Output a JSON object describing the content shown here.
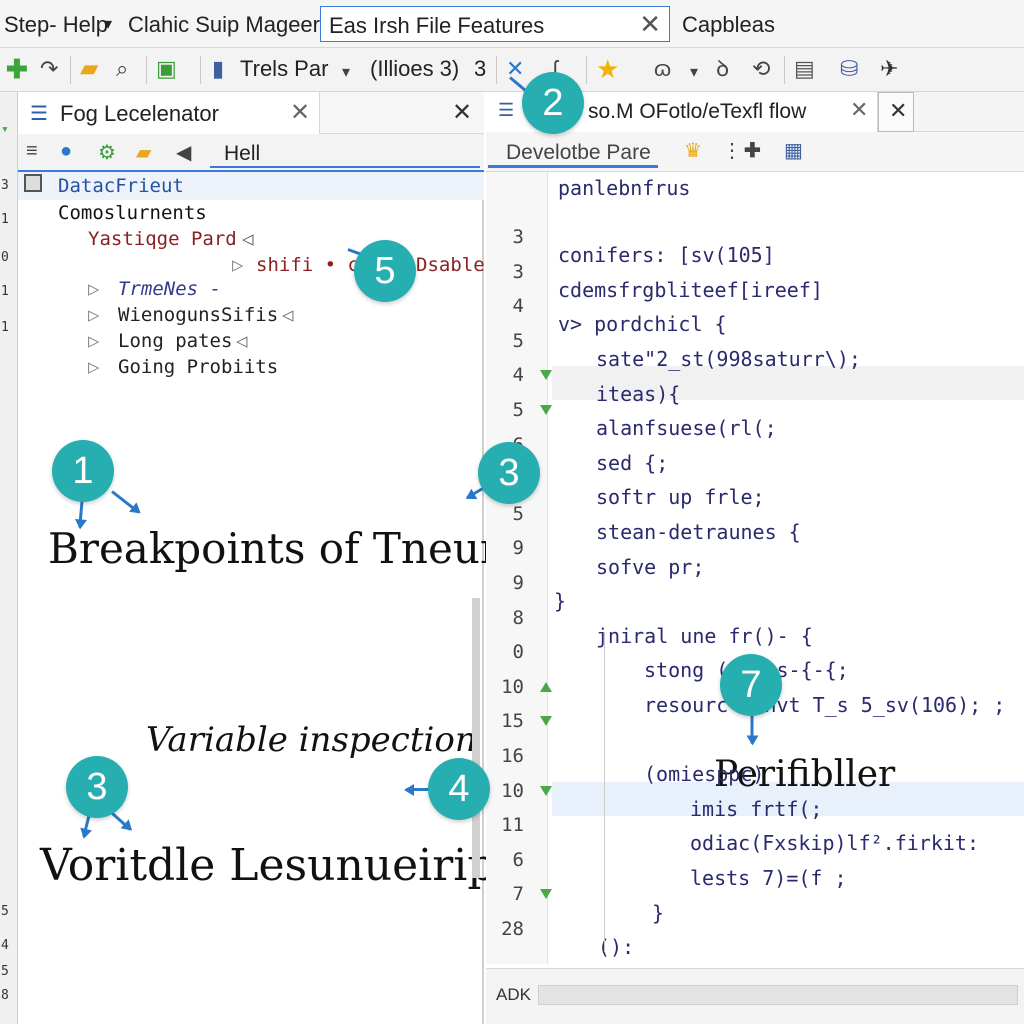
{
  "menubar": {
    "items": [
      "Step- Help",
      "Clahic Suip Mageer"
    ],
    "search_value": "Eas Irsh File Features",
    "right_item": "Capbleas"
  },
  "toolbar": {
    "dropdown_label": "Trels Par",
    "run_config": "(Illioes 3)"
  },
  "left_panel": {
    "tab_title": "Fog Lecelenator",
    "filter_value": "Hell",
    "tree": {
      "root": "DatacFrieut",
      "group": "Comoslurnents",
      "item_a": "Yastiqge Pard",
      "item_b_prefix": "shifi • con",
      "item_b_suffix": "Dsable",
      "children": [
        "TrmeNes -",
        "WienogunsSifis",
        "Long pates",
        "Going Probiits"
      ]
    },
    "annotations": {
      "breakpoints": "Breakpoints  of  Tneurose",
      "variable_inspection": "Variable inspection",
      "voritdle": "Voritdle  Lesunueirip"
    }
  },
  "right_panel": {
    "tab_title": "so.M OFotlo/eTexfl flow",
    "filter_value": "Develotbe Pare",
    "line_numbers": [
      "3",
      "3",
      "4",
      "5",
      "4",
      "5",
      "6",
      "7",
      "5",
      "9",
      "9",
      "8",
      "0",
      "10",
      "15",
      "16",
      "10",
      "11",
      "6",
      "7",
      "28"
    ],
    "code_lines": [
      "panlebnfrus",
      "",
      "conifers: [sv(105]",
      "cdemsfrgbliteef[ireef]",
      "v> pordchicl {",
      "sate\"2_st(998saturr\\);",
      "iteas){",
      "alanfsuese(rl(;",
      "sed {;",
      "softr up frle;",
      "stean-detraunes {",
      "sofve pr;",
      "}",
      "jniral une fr()- {",
      "stong (arl s-{-{;",
      "resourc  renvt T_s 5_sv(106); ;",
      "",
      "(omiesppc)",
      "imis frtf(;",
      "odiac(Fxskip)lf².firkit:",
      "lests 7)=(f ;",
      "}",
      "():"
    ],
    "overlay_label": "Perifibller",
    "status_label": "ADK"
  },
  "badges": [
    "1",
    "2",
    "3",
    "3",
    "4",
    "5",
    "7"
  ],
  "colors": {
    "accent": "#3b7bd9",
    "badge": "#27aeb0",
    "code_text": "#2a2a6e",
    "breakpoint_marker": "#4aa84a"
  }
}
